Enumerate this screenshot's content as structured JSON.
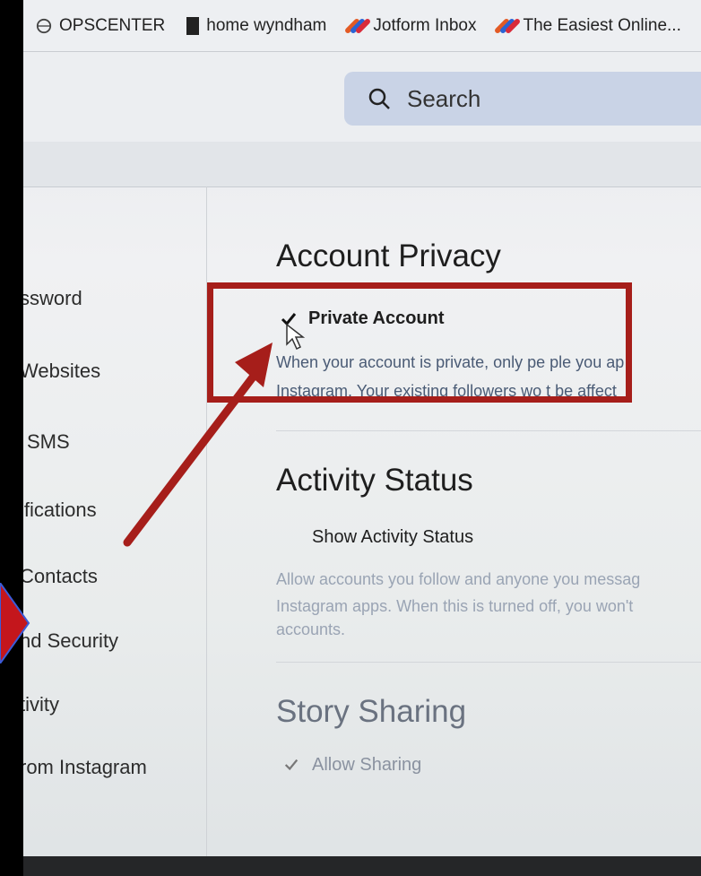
{
  "bookmarks": [
    {
      "label": "OPSCENTER",
      "icon": "globe-icon"
    },
    {
      "label": "home wyndham",
      "icon": "building-icon"
    },
    {
      "label": "Jotform Inbox",
      "icon": "jotform-icon"
    },
    {
      "label": "The Easiest Online...",
      "icon": "jotform-icon"
    }
  ],
  "search": {
    "placeholder": "Search",
    "icon": "search-icon"
  },
  "sidebar": {
    "items": [
      {
        "label": "ssword"
      },
      {
        "label": "Websites"
      },
      {
        "label": "SMS"
      },
      {
        "label": "ifications"
      },
      {
        "label": "Contacts"
      },
      {
        "label": "nd Security"
      },
      {
        "label": "tivity"
      },
      {
        "label": "rom Instagram"
      }
    ]
  },
  "privacy": {
    "heading": "Account Privacy",
    "option_label": "Private Account",
    "checked": true,
    "desc_line1": "When your account is private, only pe ple you ap",
    "desc_line2": "Instagram. Your existing followers wo t be affect"
  },
  "activity": {
    "heading": "Activity Status",
    "option_label": "Show Activity Status",
    "checked": false,
    "desc_line1": "Allow accounts you follow and anyone you messag",
    "desc_line2": "Instagram apps. When this is turned off, you won't",
    "desc_line3": "accounts."
  },
  "story": {
    "heading": "Story Sharing",
    "option_label": "Allow Sharing",
    "checked": true
  },
  "colors": {
    "annotation_red": "#a61e1a",
    "search_bg": "#c9d3e6",
    "link_text": "#4a5b75"
  }
}
